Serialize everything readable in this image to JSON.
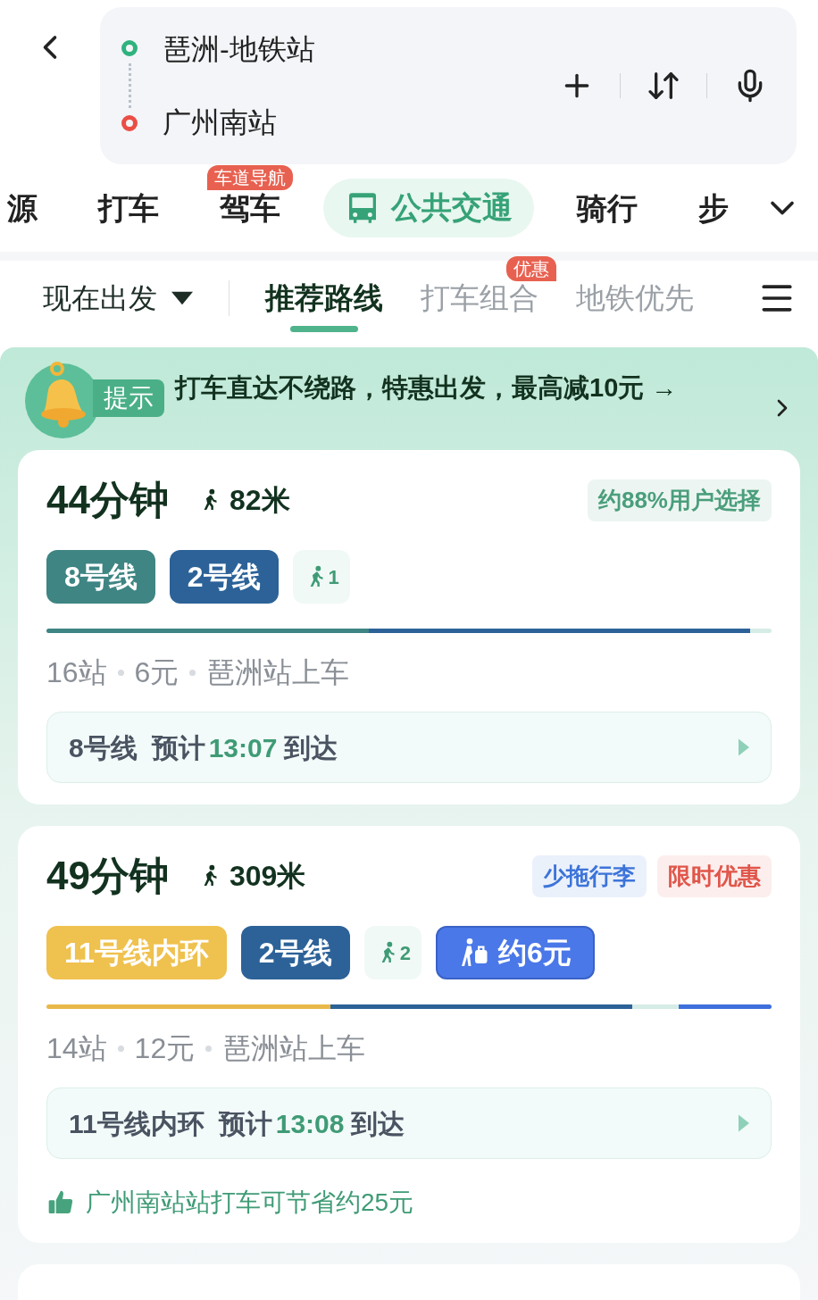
{
  "search": {
    "origin": "琶洲-地铁站",
    "destination": "广州南站"
  },
  "modes": [
    {
      "label": "源",
      "selected": false
    },
    {
      "label": "打车",
      "selected": false
    },
    {
      "label": "驾车",
      "selected": false,
      "badge": "车道导航"
    },
    {
      "label": "公共交通",
      "selected": true
    },
    {
      "label": "骑行",
      "selected": false
    },
    {
      "label": "步",
      "selected": false
    }
  ],
  "depart": "现在出发",
  "sort_tabs": [
    {
      "label": "推荐路线",
      "selected": true
    },
    {
      "label": "打车组合",
      "selected": false,
      "badge": "优惠"
    },
    {
      "label": "地铁优先",
      "selected": false
    }
  ],
  "banner": {
    "tag": "提示",
    "text": "打车直达不绕路，特惠出发，最高减10元 →"
  },
  "routes": [
    {
      "duration": "44分钟",
      "walk": "82米",
      "tags": [
        {
          "text": "约88%用户选择",
          "color": "#4a9e7c"
        }
      ],
      "chips": [
        {
          "kind": "line",
          "text": "8号线",
          "color": "#3e8583"
        },
        {
          "kind": "line",
          "text": "2号线",
          "color": "#2c6298"
        },
        {
          "kind": "walk",
          "text": "1"
        }
      ],
      "segments": [
        {
          "color": "#3e8583"
        },
        {
          "color": "#2c6298"
        },
        {
          "color": "#d6ece6"
        }
      ],
      "stats": [
        "16站",
        "6元",
        "琶洲站上车"
      ],
      "next": {
        "line": "8号线",
        "label": "预计",
        "time": "13:07",
        "suffix": "到达"
      }
    },
    {
      "duration": "49分钟",
      "walk": "309米",
      "tags": [
        {
          "text": "少拖行李",
          "color": "#3d74d9"
        },
        {
          "text": "限时优惠",
          "color": "#e0564a"
        }
      ],
      "chips": [
        {
          "kind": "line",
          "text": "11号线内环",
          "color": "#efc14e"
        },
        {
          "kind": "line",
          "text": "2号线",
          "color": "#2c6298"
        },
        {
          "kind": "walk",
          "text": "2"
        },
        {
          "kind": "taxi",
          "text": "约6元",
          "color": "#4a78e8"
        }
      ],
      "segments": [
        {
          "color": "#e8b94a"
        },
        {
          "color": "#2c6298"
        },
        {
          "color": "#d6ece6"
        },
        {
          "color": "#3f6fdc"
        }
      ],
      "stats": [
        "14站",
        "12元",
        "琶洲站上车"
      ],
      "next": {
        "line": "11号线内环",
        "label": "预计",
        "time": "13:08",
        "suffix": "到达"
      },
      "tip": "广州南站站打车可节省约25元"
    }
  ]
}
